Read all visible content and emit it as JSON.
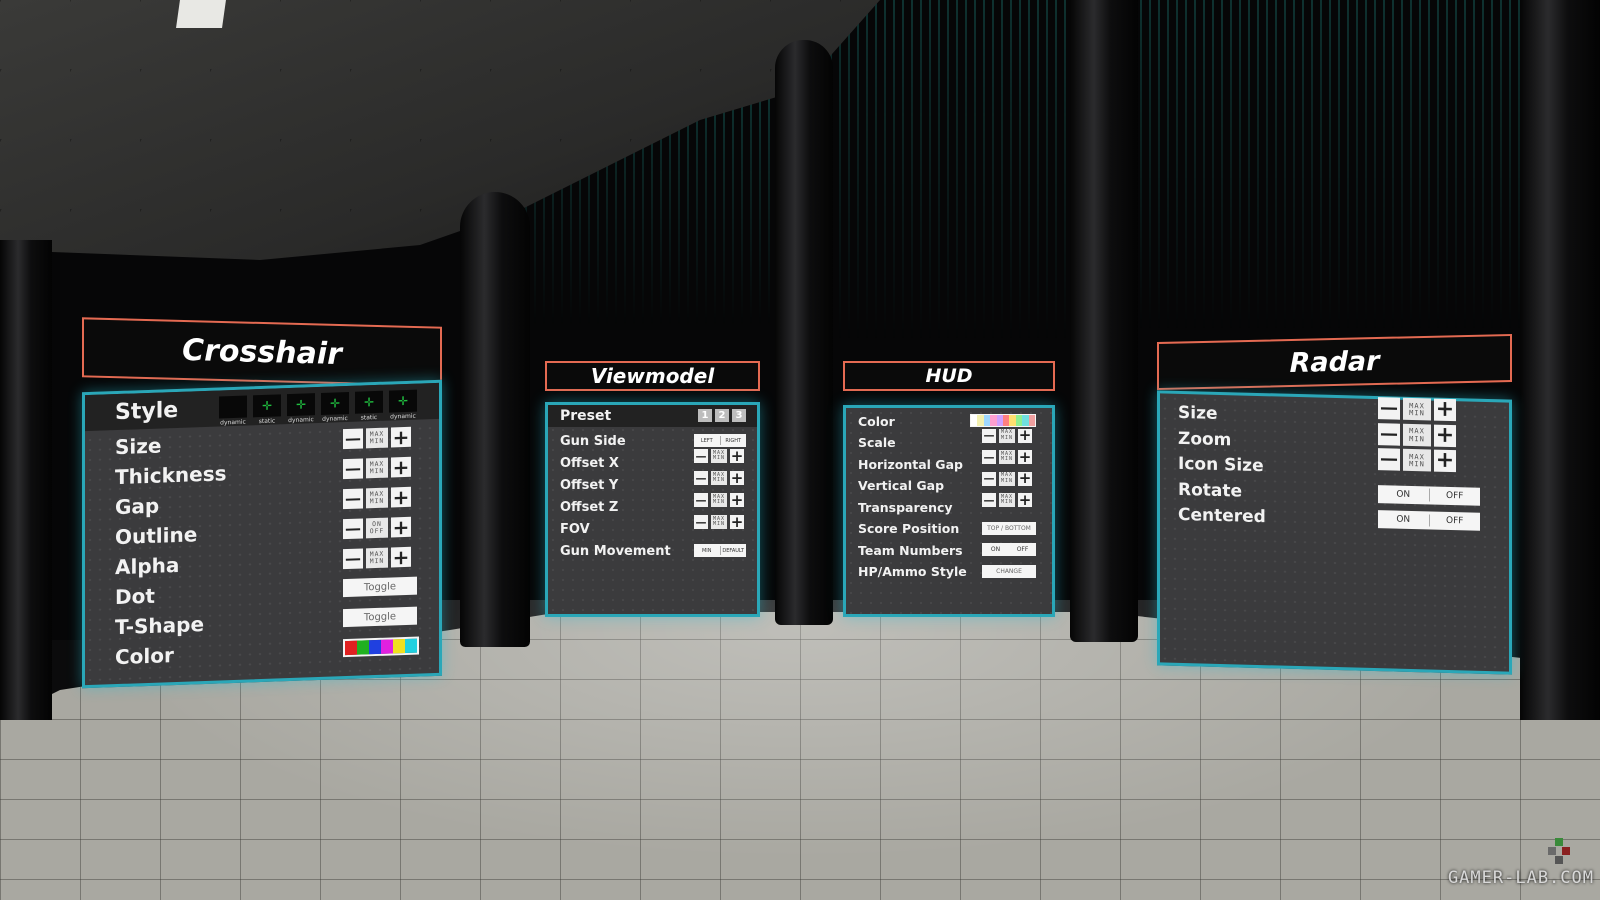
{
  "crosshair": {
    "title": "Crosshair",
    "style_label": "Style",
    "style_options": [
      "dynamic",
      "static",
      "dynamic",
      "dynamic",
      "static",
      "dynamic"
    ],
    "rows": [
      {
        "label": "Size",
        "control": "stepper"
      },
      {
        "label": "Thickness",
        "control": "stepper"
      },
      {
        "label": "Gap",
        "control": "stepper"
      },
      {
        "label": "Outline",
        "control": "onoff-stepper"
      },
      {
        "label": "Alpha",
        "control": "stepper"
      },
      {
        "label": "Dot",
        "control": "toggle"
      },
      {
        "label": "T-Shape",
        "control": "toggle"
      },
      {
        "label": "Color",
        "control": "colors"
      }
    ],
    "minus": "—",
    "plus": "+",
    "max": "MAX",
    "min": "MIN",
    "on": "ON",
    "off": "OFF",
    "toggle_label": "Toggle",
    "colors": [
      "#e02020",
      "#20b020",
      "#2040e0",
      "#e020e0",
      "#f0e020",
      "#20d0e0"
    ]
  },
  "viewmodel": {
    "title": "Viewmodel",
    "preset_label": "Preset",
    "presets": [
      "1",
      "2",
      "3"
    ],
    "rows": [
      {
        "label": "Gun Side"
      },
      {
        "label": "Offset X"
      },
      {
        "label": "Offset Y"
      },
      {
        "label": "Offset Z"
      },
      {
        "label": "FOV"
      },
      {
        "label": "Gun Movement"
      }
    ],
    "left": "LEFT",
    "right": "RIGHT",
    "min_default_a": "MIN",
    "min_default_b": "DEFAULT"
  },
  "hud": {
    "title": "HUD",
    "rows": [
      {
        "label": "Color"
      },
      {
        "label": "Scale"
      },
      {
        "label": "Horizontal Gap"
      },
      {
        "label": "Vertical Gap"
      },
      {
        "label": "Transparency"
      },
      {
        "label": "Score Position"
      },
      {
        "label": "Team Numbers"
      },
      {
        "label": "HP/Ammo Style"
      }
    ],
    "top_bottom": "TOP / BOTTOM",
    "on": "ON",
    "off": "OFF",
    "change": "CHANGE",
    "colors": [
      "#ffffff",
      "#f3f0b0",
      "#9fd8ff",
      "#ff9fd0",
      "#d0a0ff",
      "#ff8080",
      "#ffe070",
      "#90f090",
      "#70e0e0",
      "#f0a0a0"
    ]
  },
  "radar": {
    "title": "Radar",
    "rows": [
      {
        "label": "Size"
      },
      {
        "label": "Zoom"
      },
      {
        "label": "Icon Size"
      },
      {
        "label": "Rotate"
      },
      {
        "label": "Centered"
      }
    ],
    "minus": "—",
    "plus": "+",
    "max": "MAX",
    "min": "MIN",
    "on": "ON",
    "off": "OFF"
  },
  "watermark": "GAMER-LAB.COM",
  "accents": {
    "title_border": "#e46a52",
    "panel_border": "#2aa7b8",
    "matrix": "#28b4aa"
  }
}
